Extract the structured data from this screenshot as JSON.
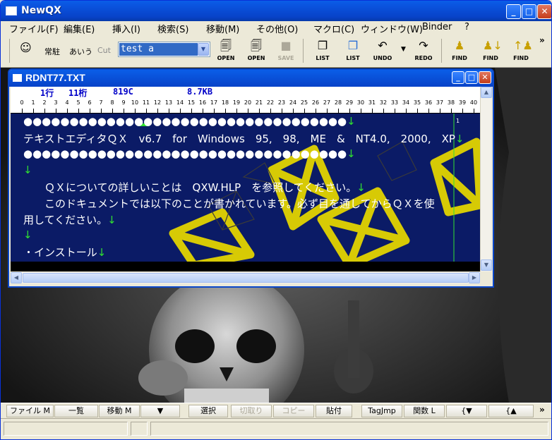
{
  "app": {
    "title": "NewQX"
  },
  "menu": [
    {
      "label": "ファイル(F)"
    },
    {
      "label": "編集(E)"
    },
    {
      "label": "挿入(I)"
    },
    {
      "label": "検索(S)"
    },
    {
      "label": "移動(M)"
    },
    {
      "label": "その他(O)"
    },
    {
      "label": "マクロ(C)"
    },
    {
      "label": "ウィンドウ(W)"
    },
    {
      "label": "Binder"
    },
    {
      "label": "?"
    }
  ],
  "toolbar": {
    "resident_label": "常駐",
    "ime_label": "あいう",
    "cut_label": "Cut",
    "search_value": "test a",
    "buttons": [
      {
        "label": "OPEN",
        "icon": "open-icon"
      },
      {
        "label": "OPEN",
        "icon": "open-icon"
      },
      {
        "label": "SAVE",
        "icon": "save-icon",
        "disabled": true
      },
      {
        "label": "LIST",
        "icon": "list-icon"
      },
      {
        "label": "LIST",
        "icon": "list-icon"
      },
      {
        "label": "UNDO",
        "icon": "undo-icon"
      },
      {
        "label": "REDO",
        "icon": "redo-icon"
      },
      {
        "label": "FIND",
        "icon": "find-icon"
      },
      {
        "label": "FIND",
        "icon": "find-next-icon"
      },
      {
        "label": "FIND",
        "icon": "find-prev-icon"
      }
    ],
    "overflow": "»"
  },
  "document": {
    "title": "RDNT77.TXT",
    "status": {
      "line": "1行",
      "column": "11桁",
      "code": "819C",
      "size": "8.7KB"
    },
    "ruler": [
      "0",
      "1",
      "2",
      "3",
      "4",
      "5",
      "6",
      "7",
      "8",
      "9",
      "10",
      "11",
      "12",
      "13",
      "14",
      "15",
      "16",
      "17",
      "18",
      "19",
      "20",
      "21",
      "22",
      "23",
      "24",
      "25",
      "26",
      "27",
      "28",
      "29",
      "30",
      "31",
      "32",
      "33",
      "34",
      "35",
      "36",
      "37",
      "38",
      "39",
      "40"
    ],
    "lines": [
      "●●●●●●●●●●●●●●●●●●●●●●●●●●●●●●●●●●●",
      "テキストエディタＱＸ　v6.7　for　Windows　95,　98,　ME　&　NT4.0,　2000,　XP",
      "●●●●●●●●●●●●●●●●●●●●●●●●●●●●●●●●●●●",
      "",
      "　　ＱＸについての詳しいことは　QXW.HLP　を参照してください。",
      "　　このドキュメントでは以下のことが書かれています。必ず目を通してからＱＸを使",
      "用してください。",
      "",
      "・インストール"
    ],
    "newline_mark": "↓",
    "line_number_marker": "1"
  },
  "funcbar": [
    {
      "label": "ファイル M"
    },
    {
      "label": "一覧"
    },
    {
      "label": "移動 M"
    },
    {
      "label": "▼"
    },
    {
      "label": "選択"
    },
    {
      "label": "切取り",
      "disabled": true
    },
    {
      "label": "コピー",
      "disabled": true
    },
    {
      "label": "貼付"
    },
    {
      "label": "TagJmp"
    },
    {
      "label": "関数 L"
    },
    {
      "label": "{▼"
    },
    {
      "label": "{▲"
    }
  ],
  "funcbar_overflow": "»",
  "colors": {
    "titlebar": "#0a55e0",
    "editor_bg": "#0b1b66",
    "newline": "#30e030",
    "status_text": "#0000c8"
  }
}
